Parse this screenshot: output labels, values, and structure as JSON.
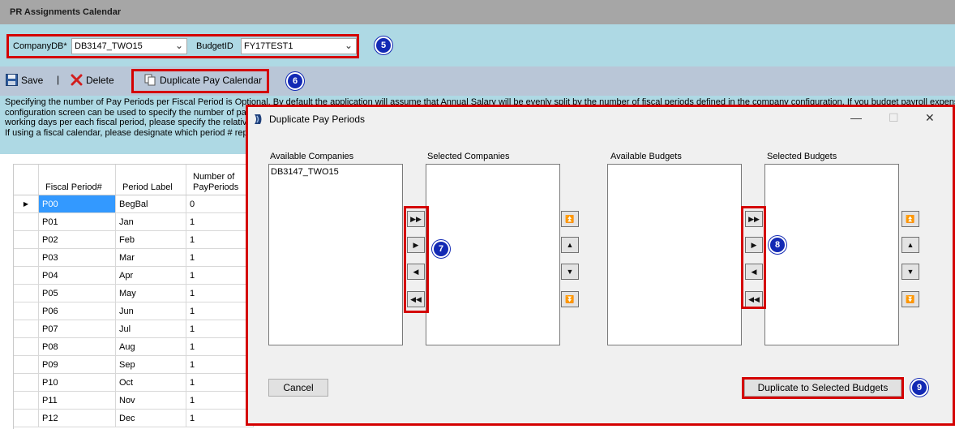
{
  "window": {
    "title": "PR Assignments Calendar"
  },
  "filters": {
    "company_label": "CompanyDB*",
    "company_value": "DB3147_TWO15",
    "budget_label": "BudgetID",
    "budget_value": "FY17TEST1"
  },
  "toolbar": {
    "save_label": "Save",
    "separator": "|",
    "delete_label": "Delete",
    "duplicate_label": "Duplicate Pay Calendar"
  },
  "info": {
    "lines": [
      "Specifying the number of Pay Periods per Fiscal Period is Optional. By default the application will assume that Annual Salary will be evenly split by the number of fiscal periods defined in the company configuration. If you budget payroll expense e",
      "configuration screen can be used to specify the number of pa",
      "working days per each fiscal period, please specify the relative",
      "If using a fiscal calendar, please designate which period # rep"
    ]
  },
  "grid": {
    "headers": [
      "Fiscal Period#",
      "Period Label",
      "Number of PayPeriods"
    ],
    "rows": [
      {
        "period": "P00",
        "label": "BegBal",
        "count": "0"
      },
      {
        "period": "P01",
        "label": "Jan",
        "count": "1"
      },
      {
        "period": "P02",
        "label": "Feb",
        "count": "1"
      },
      {
        "period": "P03",
        "label": "Mar",
        "count": "1"
      },
      {
        "period": "P04",
        "label": "Apr",
        "count": "1"
      },
      {
        "period": "P05",
        "label": "May",
        "count": "1"
      },
      {
        "period": "P06",
        "label": "Jun",
        "count": "1"
      },
      {
        "period": "P07",
        "label": "Jul",
        "count": "1"
      },
      {
        "period": "P08",
        "label": "Aug",
        "count": "1"
      },
      {
        "period": "P09",
        "label": "Sep",
        "count": "1"
      },
      {
        "period": "P10",
        "label": "Oct",
        "count": "1"
      },
      {
        "period": "P11",
        "label": "Nov",
        "count": "1"
      },
      {
        "period": "P12",
        "label": "Dec",
        "count": "1"
      }
    ]
  },
  "dialog": {
    "title": "Duplicate Pay Periods",
    "available_companies_label": "Available Companies",
    "available_companies": [
      "DB3147_TWO15"
    ],
    "selected_companies_label": "Selected Companies",
    "available_budgets_label": "Available Budgets",
    "selected_budgets_label": "Selected Budgets",
    "cancel_label": "Cancel",
    "duplicate_label": "Duplicate to Selected Budgets"
  },
  "callouts": [
    "5",
    "6",
    "7",
    "8",
    "9"
  ],
  "colors": {
    "highlight_box": "#d40000",
    "callout_badge": "#1229b4",
    "filter_bar": "#aed9e4",
    "toolbar": "#b9c6d7",
    "selected_cell": "#3399ff"
  }
}
